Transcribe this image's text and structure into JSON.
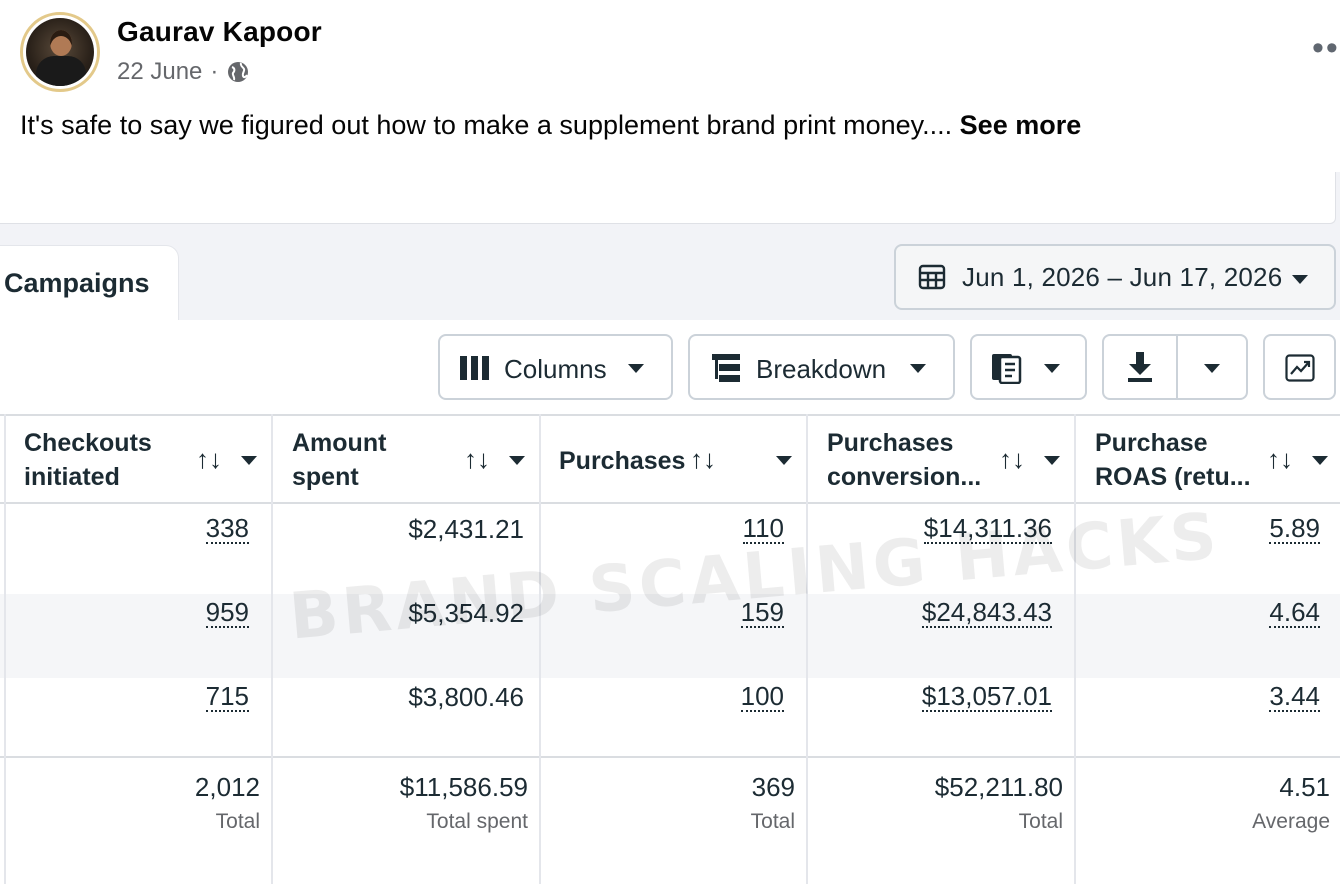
{
  "post": {
    "author": "Gaurav Kapoor",
    "date": "22 June",
    "separator": "·",
    "text": "It's safe to say we figured out how to make a supplement brand print money....",
    "see_more": "See more",
    "more_icon": "•••"
  },
  "ads_manager": {
    "tab_label": "Campaigns",
    "date_range": "Jun 1, 2026 – Jun 17, 2026",
    "toolbar": {
      "columns_label": "Columns",
      "breakdown_label": "Breakdown"
    },
    "watermark": "BRAND SCALING HACKS",
    "columns": [
      {
        "line1": "Checkouts",
        "line2": "initiated"
      },
      {
        "line1": "Amount",
        "line2": "spent"
      },
      {
        "line1": "Purchases",
        "line2": ""
      },
      {
        "line1": "Purchases",
        "line2": "conversion..."
      },
      {
        "line1": "Purchase",
        "line2": "ROAS (retu..."
      }
    ],
    "sort_glyph": "↑↓",
    "rows": [
      [
        "338",
        "$2,431.21",
        "110",
        "$14,311.36",
        "5.89"
      ],
      [
        "959",
        "$5,354.92",
        "159",
        "$24,843.43",
        "4.64"
      ],
      [
        "715",
        "$3,800.46",
        "100",
        "$13,057.01",
        "3.44"
      ]
    ],
    "totals": [
      {
        "value": "2,012",
        "label": "Total"
      },
      {
        "value": "$11,586.59",
        "label": "Total spent"
      },
      {
        "value": "369",
        "label": "Total"
      },
      {
        "value": "$52,211.80",
        "label": "Total"
      },
      {
        "value": "4.51",
        "label": "Average"
      }
    ]
  }
}
